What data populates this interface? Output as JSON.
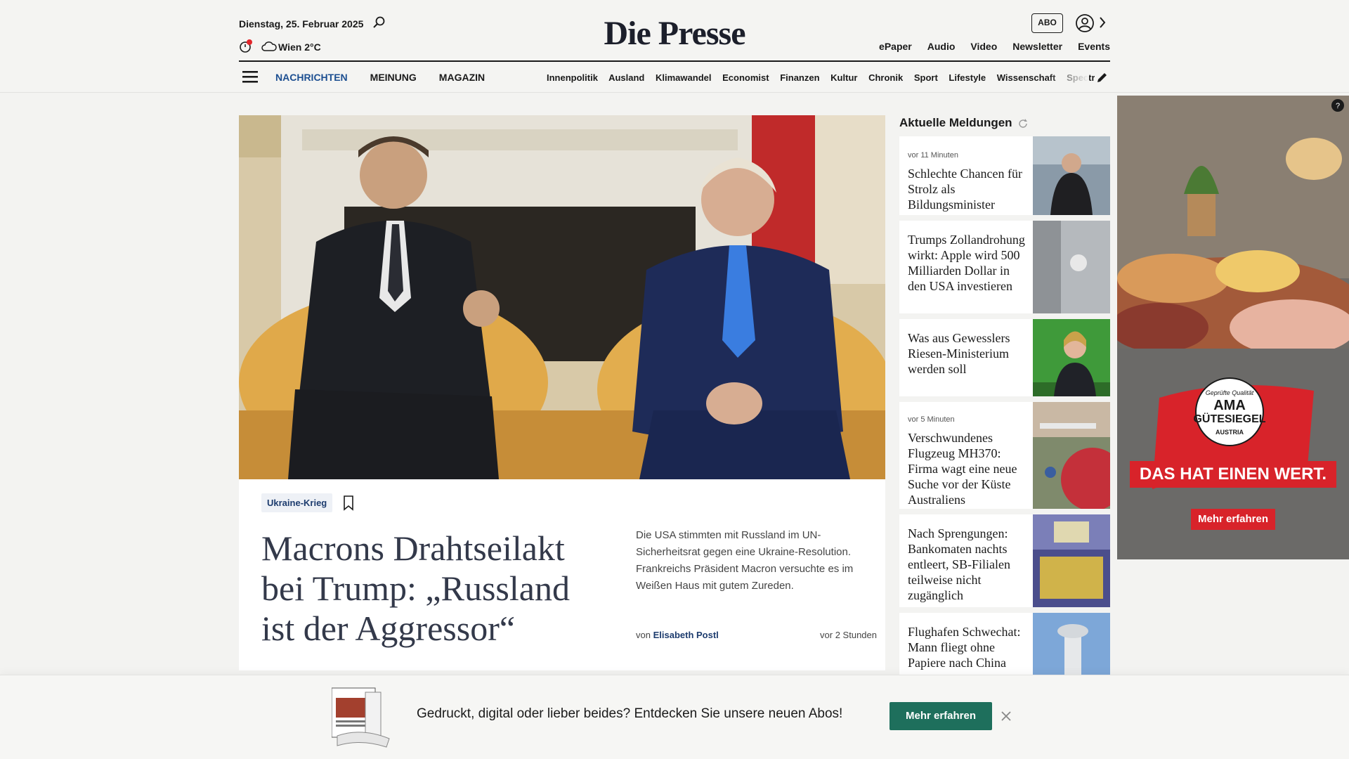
{
  "header": {
    "date": "Dienstag, 25. Februar 2025",
    "weather": "Wien 2°C",
    "logo": "Die Presse",
    "abo_label": "ABO",
    "top_links": [
      "ePaper",
      "Audio",
      "Video",
      "Newsletter",
      "Events"
    ],
    "main_nav": [
      "NACHRICHTEN",
      "MEINUNG",
      "MAGAZIN"
    ],
    "sub_nav": [
      "Innenpolitik",
      "Ausland",
      "Klimawandel",
      "Economist",
      "Finanzen",
      "Kultur",
      "Chronik",
      "Sport",
      "Lifestyle",
      "Wissenschaft",
      "Spectrum"
    ],
    "colors": {
      "accent": "#1d4f91",
      "logo": "#1c1f2b"
    }
  },
  "hero": {
    "tag": "Ukraine-Krieg",
    "headline": "Macrons Drahtseilakt bei Trump: „Russland ist der Aggressor“",
    "teaser": "Die USA stimmten mit Russland im UN-Sicherheitsrat gegen eine Ukraine-Resolution. Frankreichs Präsident Macron versuchte es im Weißen Haus mit gutem Zureden.",
    "byline_prefix": "von",
    "author": "Elisabeth Postl",
    "time": "vor 2 Stunden"
  },
  "news": {
    "title": "Aktuelle Meldungen",
    "items": [
      {
        "meta": "vor 11 Minuten",
        "title": "Schlechte Chancen für Strolz als Bildungsminister"
      },
      {
        "meta": "",
        "title": "Trumps Zollandrohung wirkt: Apple wird 500 Milliarden Dollar in den USA investieren"
      },
      {
        "meta": "",
        "title": "Was aus Gewesslers Riesen-Ministerium werden soll"
      },
      {
        "meta": "vor 5 Minuten",
        "title": "Verschwundenes Flugzeug MH370: Firma wagt eine neue Suche vor der Küste Australiens"
      },
      {
        "meta": "",
        "title": "Nach Sprengungen: Bankomaten nachts entleert, SB-Filialen teilweise nicht zugänglich"
      },
      {
        "meta": "",
        "title": "Flughafen Schwechat: Mann fliegt ohne Papiere nach China"
      }
    ]
  },
  "ad": {
    "seal_top": "Geprüfte Qualität",
    "seal_main1": "AMA",
    "seal_main2": "GÜTESIEGEL",
    "seal_bottom": "AUSTRIA",
    "slogan": "DAS HAT EINEN WERT.",
    "button": "Mehr erfahren",
    "colors": {
      "red": "#d8232a"
    }
  },
  "banner": {
    "text": "Gedruckt, digital oder lieber beides? Entdecken Sie unsere neuen Abos!",
    "button": "Mehr erfahren",
    "colors": {
      "button": "#1e6f5c"
    }
  }
}
